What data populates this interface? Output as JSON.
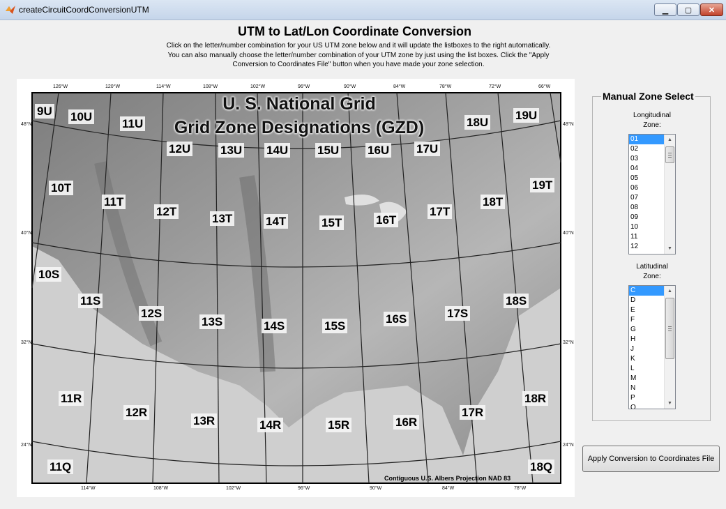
{
  "window": {
    "title": "createCircuitCoordConversionUTM",
    "icon": "matlab-icon",
    "controls": [
      "minimize",
      "maximize",
      "close"
    ]
  },
  "header": {
    "title": "UTM to Lat/Lon Coordinate Conversion",
    "instructions": "Click on the letter/number combination for your US UTM zone below and it will update the listboxes to the right automatically. You can also manually choose the letter/number combination of your UTM zone by just using the list boxes. Click the \"Apply Conversion to Coordinates File\" button when you have made your zone selection."
  },
  "map": {
    "title_line1": "U. S. National Grid",
    "title_line2": "Grid Zone Designations (GZD)",
    "caption": "Contiguous U.S. Albers Projection NAD 83",
    "zones": [
      "9U",
      "10U",
      "11U",
      "12U",
      "13U",
      "14U",
      "15U",
      "16U",
      "17U",
      "18U",
      "19U",
      "10T",
      "11T",
      "12T",
      "13T",
      "14T",
      "15T",
      "16T",
      "17T",
      "18T",
      "19T",
      "10S",
      "11S",
      "12S",
      "13S",
      "14S",
      "15S",
      "16S",
      "17S",
      "18S",
      "11R",
      "12R",
      "13R",
      "14R",
      "15R",
      "16R",
      "17R",
      "18R",
      "11Q",
      "18Q"
    ],
    "top_ticks": [
      "126°W",
      "120°W",
      "114°W",
      "108°W",
      "102°W",
      "96°W",
      "90°W",
      "84°W",
      "78°W",
      "72°W",
      "66°W"
    ],
    "bottom_ticks": [
      "114°W",
      "108°W",
      "102°W",
      "96°W",
      "90°W",
      "84°W",
      "78°W"
    ],
    "left_ticks": [
      "48°N",
      "40°N",
      "32°N",
      "24°N"
    ],
    "right_ticks": [
      "48°N",
      "40°N",
      "32°N",
      "24°N"
    ]
  },
  "zone_select": {
    "group_title": "Manual Zone Select",
    "longitudinal_label_1": "Longitudinal",
    "longitudinal_label_2": "Zone:",
    "longitudinal_options": [
      "01",
      "02",
      "03",
      "04",
      "05",
      "06",
      "07",
      "08",
      "09",
      "10",
      "11",
      "12"
    ],
    "longitudinal_selected": "01",
    "latitudinal_label_1": "Latitudinal",
    "latitudinal_label_2": "Zone:",
    "latitudinal_options": [
      "C",
      "D",
      "E",
      "F",
      "G",
      "H",
      "J",
      "K",
      "L",
      "M",
      "N",
      "P",
      "Q"
    ],
    "latitudinal_selected": "C"
  },
  "actions": {
    "apply_label": "Apply Conversion to Coordinates File"
  }
}
